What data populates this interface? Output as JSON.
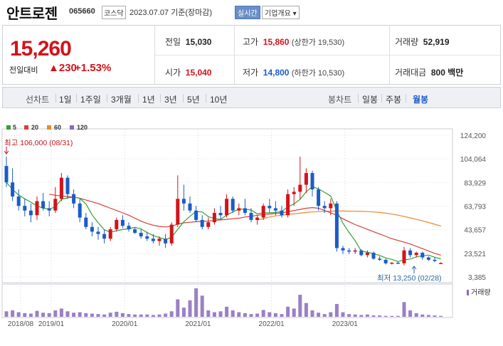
{
  "header": {
    "name": "안트로젠",
    "code": "065660",
    "market": "코스닥",
    "date": "2023.07.07",
    "basis": "기준(장마감)",
    "realtime_label": "실시간",
    "info_label": "기업개요 ▾"
  },
  "quote": {
    "price": "15,260",
    "diff_label": "전일대비",
    "diff_value": "▲230",
    "diff_pct": "+1.53%",
    "prev_label": "전일",
    "prev_value": "15,030",
    "high_label": "고가",
    "high_value": "15,860",
    "upper_limit": "(상한가 19,530)",
    "volume_label": "거래량",
    "volume_value": "52,919",
    "open_label": "시가",
    "open_value": "15,040",
    "low_label": "저가",
    "low_value": "14,800",
    "lower_limit": "(하한가 10,530)",
    "amount_label": "거래대금",
    "amount_value": "800 백만"
  },
  "toolbar": {
    "line_chart_label": "선차트",
    "line_options": [
      "1일",
      "1주일",
      "3개월",
      "1년",
      "3년",
      "5년",
      "10년"
    ],
    "candle_chart_label": "봉차트",
    "candle_options": [
      "일봉",
      "주봉",
      "월봉"
    ],
    "active_candle": "월봉"
  },
  "colors": {
    "up": "#d3131a",
    "down": "#1a5cc8",
    "ma5": "#35a12e",
    "ma20": "#d43f3a",
    "ma60": "#e8892b",
    "ma120": "#8e68b6"
  },
  "chart_data": {
    "type": "candlestick",
    "interval": "monthly",
    "legend": [
      "5",
      "20",
      "60",
      "120"
    ],
    "x_labels": [
      "2018/08",
      "2019/01",
      "2020/01",
      "2021/01",
      "2022/01",
      "2023/01"
    ],
    "y_ticks": [
      "124,200",
      "104,064",
      "83,929",
      "63,793",
      "43,657",
      "23,521",
      "3,385"
    ],
    "ylim": [
      3385,
      124200
    ],
    "max_annotation": "최고 106,000 (08/31)",
    "min_annotation": "최저 13,250 (02/28)",
    "volume_label": "거래량",
    "candles": [
      [
        98000,
        106000,
        80000,
        84000
      ],
      [
        84000,
        96000,
        68000,
        72000
      ],
      [
        72000,
        78000,
        60000,
        64000
      ],
      [
        64000,
        70000,
        55000,
        60000
      ],
      [
        60000,
        66000,
        50000,
        56000
      ],
      [
        56000,
        72000,
        52000,
        68000
      ],
      [
        68000,
        75000,
        60000,
        62000
      ],
      [
        62000,
        68000,
        55000,
        60000
      ],
      [
        60000,
        80000,
        58000,
        70000
      ],
      [
        70000,
        92000,
        68000,
        88000
      ],
      [
        88000,
        90000,
        70000,
        74000
      ],
      [
        74000,
        78000,
        62000,
        66000
      ],
      [
        66000,
        70000,
        50000,
        54000
      ],
      [
        54000,
        58000,
        44000,
        46000
      ],
      [
        46000,
        50000,
        38000,
        42000
      ],
      [
        42000,
        46000,
        35000,
        40000
      ],
      [
        40000,
        44000,
        32000,
        36000
      ],
      [
        36000,
        46000,
        34000,
        44000
      ],
      [
        44000,
        54000,
        42000,
        52000
      ],
      [
        52000,
        56000,
        45000,
        47000
      ],
      [
        47000,
        50000,
        42000,
        44000
      ],
      [
        44000,
        46000,
        40000,
        41000
      ],
      [
        41000,
        44000,
        36000,
        38000
      ],
      [
        38000,
        42000,
        34000,
        36000
      ],
      [
        36000,
        40000,
        32000,
        34000
      ],
      [
        34000,
        38000,
        30000,
        36000
      ],
      [
        36000,
        40000,
        28000,
        32000
      ],
      [
        32000,
        50000,
        30000,
        48000
      ],
      [
        48000,
        90000,
        46000,
        70000
      ],
      [
        70000,
        82000,
        60000,
        66000
      ],
      [
        66000,
        72000,
        58000,
        60000
      ],
      [
        60000,
        64000,
        50000,
        52000
      ],
      [
        52000,
        56000,
        44000,
        46000
      ],
      [
        46000,
        54000,
        44000,
        50000
      ],
      [
        50000,
        62000,
        48000,
        58000
      ],
      [
        58000,
        64000,
        52000,
        56000
      ],
      [
        56000,
        74000,
        54000,
        70000
      ],
      [
        70000,
        72000,
        58000,
        60000
      ],
      [
        60000,
        66000,
        56000,
        62000
      ],
      [
        62000,
        70000,
        56000,
        58000
      ],
      [
        58000,
        62000,
        50000,
        52000
      ],
      [
        52000,
        56000,
        48000,
        54000
      ],
      [
        54000,
        66000,
        52000,
        64000
      ],
      [
        64000,
        70000,
        58000,
        62000
      ],
      [
        62000,
        68000,
        56000,
        60000
      ],
      [
        60000,
        64000,
        54000,
        56000
      ],
      [
        56000,
        78000,
        54000,
        74000
      ],
      [
        74000,
        80000,
        64000,
        76000
      ],
      [
        76000,
        106000,
        70000,
        82000
      ],
      [
        82000,
        96000,
        75000,
        92000
      ],
      [
        92000,
        94000,
        72000,
        78000
      ],
      [
        78000,
        80000,
        60000,
        64000
      ],
      [
        64000,
        68000,
        58000,
        62000
      ],
      [
        62000,
        70000,
        56000,
        66000
      ],
      [
        66000,
        68000,
        25000,
        28000
      ],
      [
        28000,
        30000,
        23000,
        26000
      ],
      [
        26000,
        28000,
        23000,
        25000
      ],
      [
        25000,
        28000,
        23000,
        26000
      ],
      [
        26000,
        27000,
        21000,
        22000
      ],
      [
        22000,
        26000,
        20000,
        24000
      ],
      [
        24000,
        25000,
        18000,
        19000
      ],
      [
        19000,
        21000,
        17000,
        18000
      ],
      [
        18000,
        19000,
        14000,
        15000
      ],
      [
        15000,
        16000,
        14000,
        15500
      ],
      [
        15500,
        16500,
        14500,
        15000
      ],
      [
        15000,
        29000,
        13250,
        26000
      ],
      [
        26000,
        28000,
        20000,
        22000
      ],
      [
        22000,
        25000,
        20000,
        24000
      ],
      [
        24000,
        25000,
        18000,
        20000
      ],
      [
        20000,
        21000,
        17000,
        18000
      ],
      [
        18000,
        20000,
        16000,
        17000
      ],
      [
        15040,
        15860,
        14800,
        15260
      ]
    ],
    "volumes": [
      12,
      14,
      10,
      8,
      7,
      13,
      9,
      8,
      14,
      18,
      12,
      9,
      10,
      8,
      7,
      6,
      5,
      9,
      11,
      8,
      6,
      5,
      5,
      5,
      4,
      5,
      7,
      12,
      38,
      20,
      36,
      62,
      46,
      14,
      10,
      12,
      22,
      14,
      10,
      8,
      6,
      7,
      15,
      10,
      8,
      6,
      22,
      18,
      48,
      30,
      14,
      9,
      6,
      10,
      28,
      10,
      6,
      5,
      4,
      5,
      3,
      3,
      2,
      2,
      2,
      32,
      14,
      8,
      5,
      4,
      3,
      2
    ],
    "ma20": [
      null,
      null,
      null,
      null,
      null,
      null,
      null,
      74000,
      73000,
      72500,
      72000,
      71500,
      70500,
      69000,
      67500,
      66000,
      64000,
      62000,
      60000,
      58000,
      56000,
      53500,
      51000,
      49000,
      47500,
      46500,
      46000,
      46500,
      48500,
      49500,
      50000,
      50500,
      50800,
      51000,
      51500,
      52000,
      52500,
      53000,
      53500,
      54500,
      55000,
      56000,
      56500,
      57000,
      57500,
      58000,
      59000,
      60000,
      61000,
      62000,
      62500,
      62000,
      60000,
      58000,
      56000,
      53000,
      50500,
      48000,
      46000,
      44000,
      42000,
      40000,
      38000,
      36000,
      34500,
      33000,
      31500,
      29500,
      27500,
      25500,
      23500,
      22000
    ],
    "ma60": [
      null,
      null,
      null,
      null,
      null,
      null,
      null,
      null,
      null,
      null,
      null,
      null,
      null,
      null,
      null,
      null,
      null,
      null,
      null,
      null,
      null,
      null,
      null,
      null,
      null,
      null,
      null,
      null,
      null,
      null,
      null,
      null,
      null,
      null,
      null,
      null,
      null,
      null,
      null,
      null,
      null,
      52000,
      53000,
      54500,
      55500,
      56000,
      56800,
      57200,
      57800,
      58400,
      58800,
      59100,
      59300,
      59500,
      59600,
      59600,
      59500,
      59400,
      59300,
      59100,
      58800,
      58400,
      57800,
      57000,
      56000,
      54900,
      53800,
      52500,
      51200,
      49800,
      48300,
      46800
    ]
  }
}
